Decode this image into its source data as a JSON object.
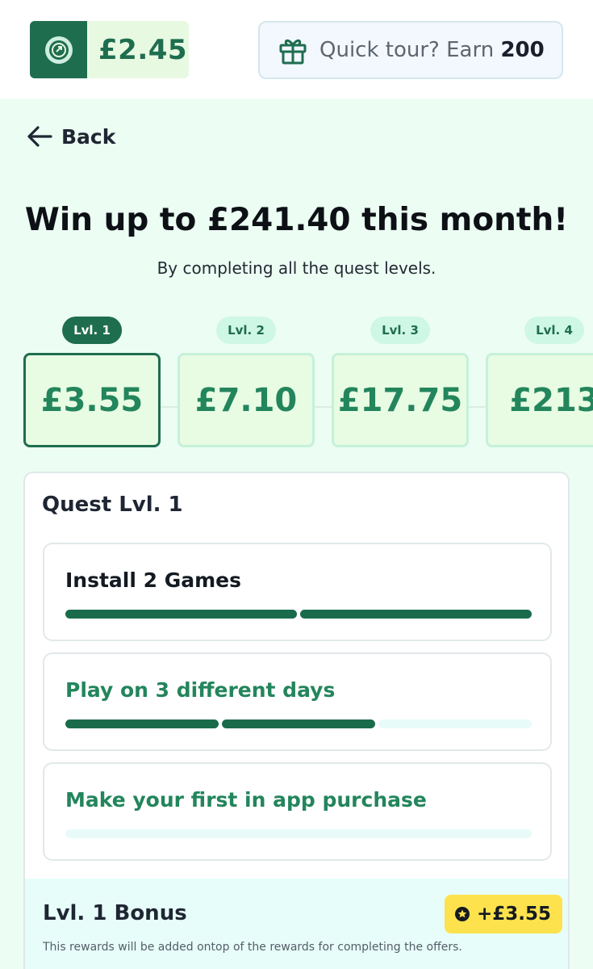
{
  "header": {
    "balance": "£2.45",
    "tour_text": "Quick tour? Earn ",
    "tour_points": "200"
  },
  "nav": {
    "back_label": "Back"
  },
  "hero": {
    "headline": "Win up to £241.40 this month!",
    "subline": "By completing all the quest levels."
  },
  "levels": [
    {
      "label": "Lvl. 1",
      "reward": "£3.55",
      "active": true
    },
    {
      "label": "Lvl. 2",
      "reward": "£7.10",
      "active": false
    },
    {
      "label": "Lvl. 3",
      "reward": "£17.75",
      "active": false
    },
    {
      "label": "Lvl. 4",
      "reward": "£213",
      "active": false
    }
  ],
  "quest": {
    "title": "Quest Lvl. 1",
    "tasks": [
      {
        "label": "Install 2 Games",
        "segments_total": 2,
        "segments_done": 2,
        "completed": true
      },
      {
        "label": "Play on 3 different days",
        "segments_total": 3,
        "segments_done": 2,
        "completed": false
      },
      {
        "label": "Make your first in app purchase",
        "segments_total": 1,
        "segments_done": 0,
        "completed": false
      }
    ],
    "bonus": {
      "title": "Lvl. 1 Bonus",
      "badge": "+£3.55",
      "note": "This rewards will be added ontop of the rewards for completing the offers."
    }
  },
  "colors": {
    "brand_green": "#1f6d4f",
    "accent_green": "#23855c",
    "page_bg": "#ecfdf3",
    "badge_yellow": "#fde24e"
  },
  "icons": {
    "balance": "coin-icon",
    "tour": "gift-icon",
    "back": "arrow-left-icon",
    "bonus": "star-coin-icon"
  }
}
